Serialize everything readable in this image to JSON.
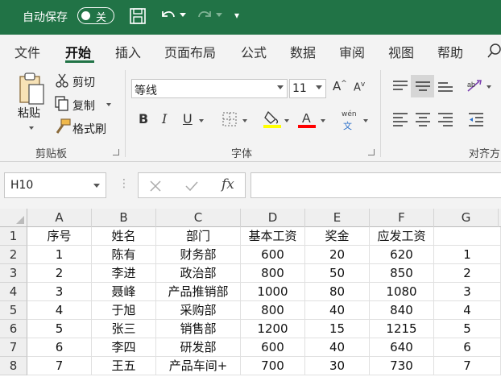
{
  "titlebar": {
    "autosave_label": "自动保存",
    "autosave_state": "关",
    "more_glyph": "▾"
  },
  "tabs": [
    {
      "label": "文件"
    },
    {
      "label": "开始",
      "active": true
    },
    {
      "label": "插入"
    },
    {
      "label": "页面布局"
    },
    {
      "label": "公式"
    },
    {
      "label": "数据"
    },
    {
      "label": "审阅"
    },
    {
      "label": "视图"
    },
    {
      "label": "帮助"
    }
  ],
  "ribbon": {
    "clipboard": {
      "paste": "粘贴",
      "cut": "剪切",
      "copy": "复制",
      "format_painter": "格式刷",
      "group_label": "剪贴板"
    },
    "font": {
      "font_name": "等线",
      "font_size": "11",
      "bold": "B",
      "italic": "I",
      "underline": "U",
      "phonetic_top": "wén",
      "phonetic_bottom": "文",
      "group_label": "字体",
      "fill_color": "#ffff00",
      "font_color": "#ff0000"
    },
    "alignment": {
      "group_label": "对齐方"
    }
  },
  "formula_bar": {
    "name_box": "H10",
    "fx": "fx"
  },
  "grid": {
    "columns": [
      "A",
      "B",
      "C",
      "D",
      "E",
      "F",
      "G"
    ],
    "rows": [
      {
        "num": "1",
        "cells": [
          "序号",
          "姓名",
          "部门",
          "基本工资",
          "奖金",
          "应发工资",
          ""
        ]
      },
      {
        "num": "2",
        "cells": [
          "1",
          "陈有",
          "财务部",
          "600",
          "20",
          "620",
          "1"
        ]
      },
      {
        "num": "3",
        "cells": [
          "2",
          "李进",
          "政治部",
          "800",
          "50",
          "850",
          "2"
        ]
      },
      {
        "num": "4",
        "cells": [
          "3",
          "聂峰",
          "产品推销部",
          "1000",
          "80",
          "1080",
          "3"
        ]
      },
      {
        "num": "5",
        "cells": [
          "4",
          "于旭",
          "采购部",
          "800",
          "40",
          "840",
          "4"
        ]
      },
      {
        "num": "6",
        "cells": [
          "5",
          "张三",
          "销售部",
          "1200",
          "15",
          "1215",
          "5"
        ]
      },
      {
        "num": "7",
        "cells": [
          "6",
          "李四",
          "研发部",
          "600",
          "40",
          "640",
          "6"
        ]
      },
      {
        "num": "8",
        "cells": [
          "7",
          "王五",
          "产品车间+",
          "700",
          "30",
          "730",
          "7"
        ]
      }
    ]
  }
}
